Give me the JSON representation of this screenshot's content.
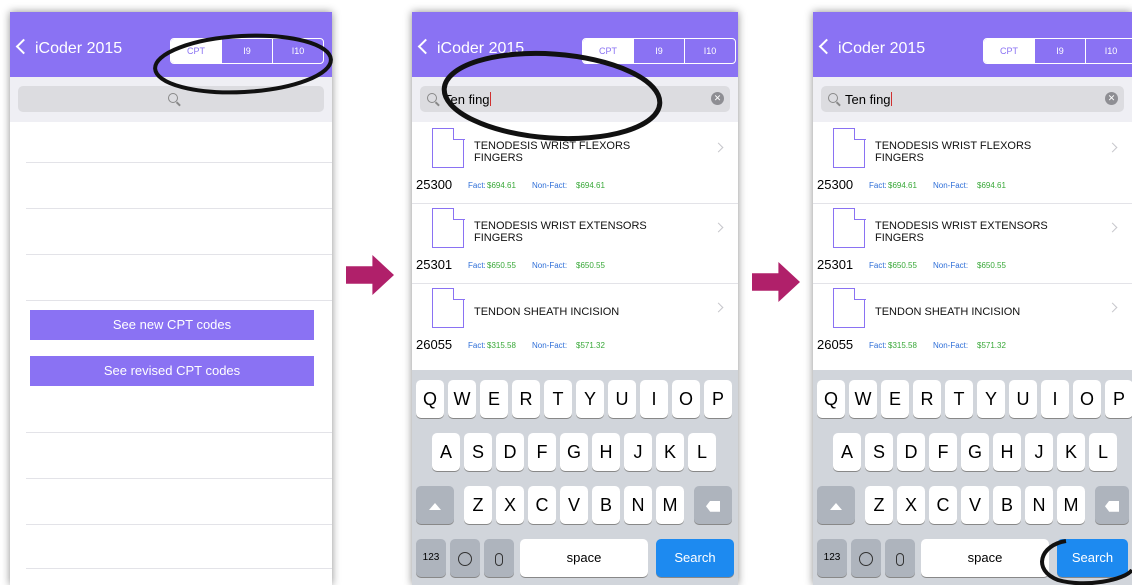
{
  "nav": {
    "back_label": "iCoder 2015",
    "segments": [
      "CPT",
      "I9",
      "I10"
    ],
    "selected": 0
  },
  "screen1": {
    "search_text": "",
    "buttons": [
      "See new CPT codes",
      "See revised CPT codes"
    ]
  },
  "search": {
    "query": "Ten fing"
  },
  "results": [
    {
      "title": "TENODESIS WRIST FLEXORS FINGERS",
      "code": "25300",
      "fact_label": "Fact:",
      "fact": "$694.61",
      "nonfact_label": "Non-Fact:",
      "nonfact": "$694.61"
    },
    {
      "title": "TENODESIS WRIST EXTENSORS FINGERS",
      "code": "25301",
      "fact_label": "Fact:",
      "fact": "$650.55",
      "nonfact_label": "Non-Fact:",
      "nonfact": "$650.55"
    },
    {
      "title": "TENDON SHEATH INCISION",
      "code": "26055",
      "fact_label": "Fact:",
      "fact": "$315.58",
      "nonfact_label": "Non-Fact:",
      "nonfact": "$571.32"
    }
  ],
  "keyboard": {
    "row1": [
      "Q",
      "W",
      "E",
      "R",
      "T",
      "Y",
      "U",
      "I",
      "O",
      "P"
    ],
    "row2": [
      "A",
      "S",
      "D",
      "F",
      "G",
      "H",
      "J",
      "K",
      "L"
    ],
    "row3": [
      "Z",
      "X",
      "C",
      "V",
      "B",
      "N",
      "M"
    ],
    "numbers": "123",
    "space": "space",
    "search": "Search"
  },
  "colors": {
    "accent": "#8a72f3",
    "arrow": "#b0206a",
    "search_key": "#1d8af0",
    "fact": "#2f6fd8",
    "nonfact": "#38a838"
  }
}
